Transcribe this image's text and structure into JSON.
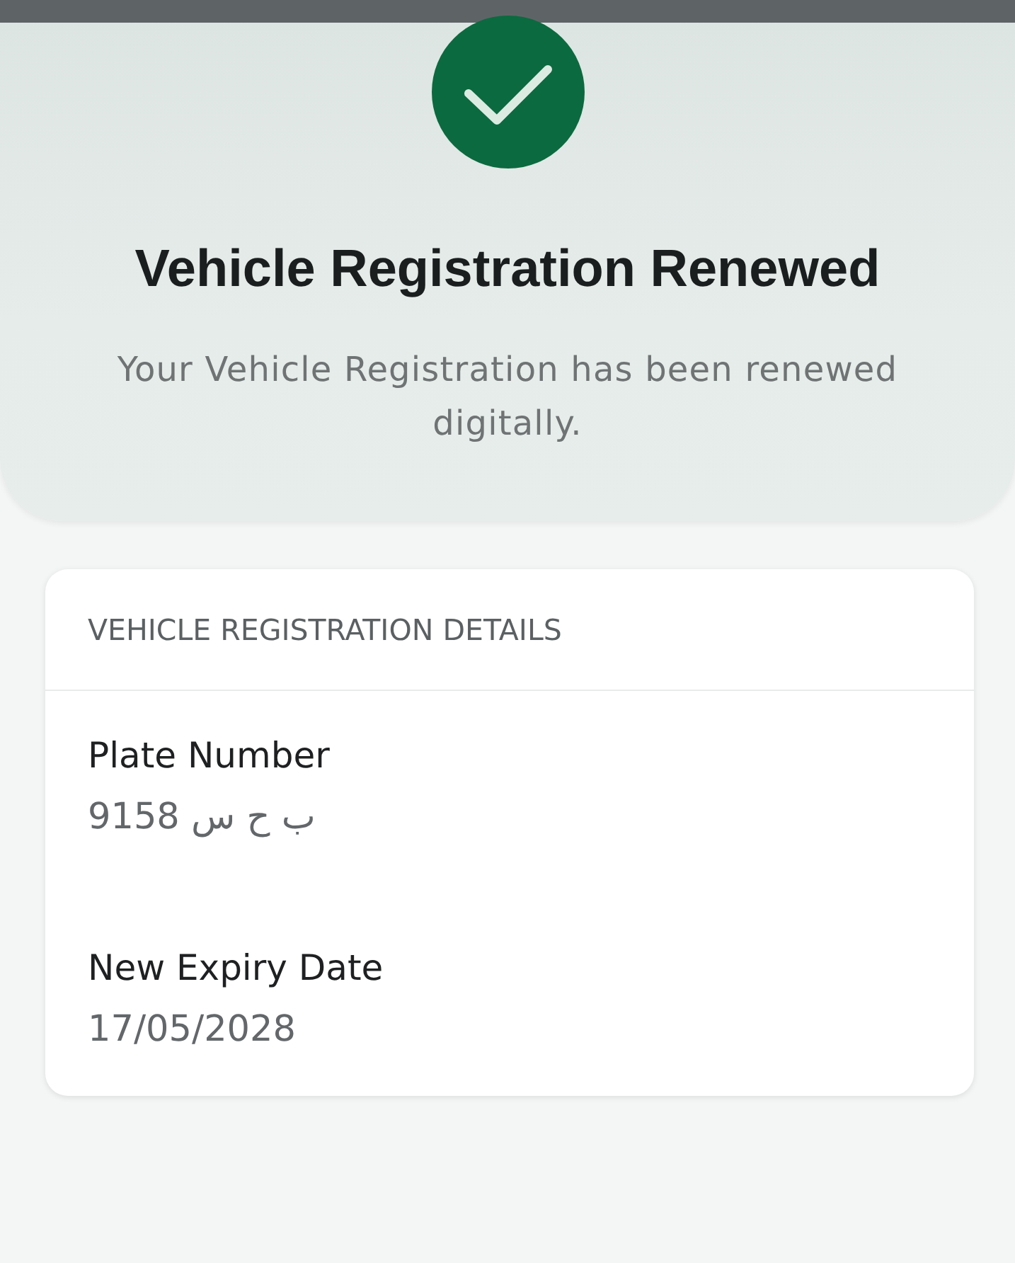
{
  "confirmation": {
    "title": "Vehicle Registration Renewed",
    "message": "Your Vehicle Registration has been renewed digitally."
  },
  "details_card": {
    "heading": "VEHICLE REGISTRATION DETAILS",
    "fields": [
      {
        "label": "Plate Number",
        "value": "9158 ب ح س"
      },
      {
        "label": "New Expiry Date",
        "value": "17/05/2028"
      }
    ]
  }
}
